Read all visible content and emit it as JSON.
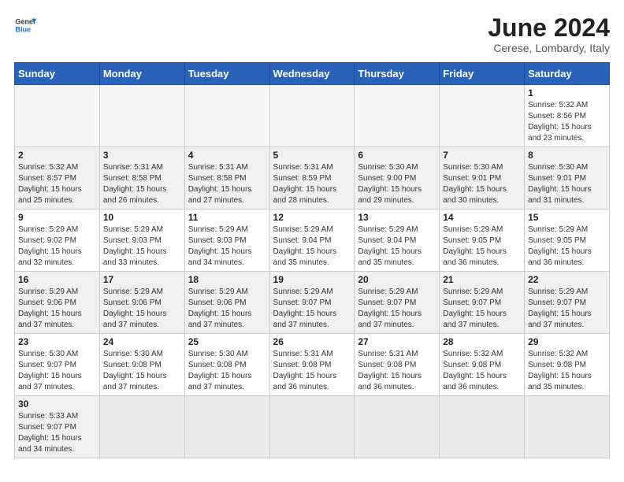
{
  "header": {
    "logo_general": "General",
    "logo_blue": "Blue",
    "month_title": "June 2024",
    "subtitle": "Cerese, Lombardy, Italy"
  },
  "days_of_week": [
    "Sunday",
    "Monday",
    "Tuesday",
    "Wednesday",
    "Thursday",
    "Friday",
    "Saturday"
  ],
  "weeks": [
    [
      {
        "day": "",
        "info": ""
      },
      {
        "day": "",
        "info": ""
      },
      {
        "day": "",
        "info": ""
      },
      {
        "day": "",
        "info": ""
      },
      {
        "day": "",
        "info": ""
      },
      {
        "day": "",
        "info": ""
      },
      {
        "day": "1",
        "info": "Sunrise: 5:32 AM\nSunset: 8:56 PM\nDaylight: 15 hours\nand 23 minutes."
      }
    ],
    [
      {
        "day": "2",
        "info": "Sunrise: 5:32 AM\nSunset: 8:57 PM\nDaylight: 15 hours\nand 25 minutes."
      },
      {
        "day": "3",
        "info": "Sunrise: 5:31 AM\nSunset: 8:58 PM\nDaylight: 15 hours\nand 26 minutes."
      },
      {
        "day": "4",
        "info": "Sunrise: 5:31 AM\nSunset: 8:58 PM\nDaylight: 15 hours\nand 27 minutes."
      },
      {
        "day": "5",
        "info": "Sunrise: 5:31 AM\nSunset: 8:59 PM\nDaylight: 15 hours\nand 28 minutes."
      },
      {
        "day": "6",
        "info": "Sunrise: 5:30 AM\nSunset: 9:00 PM\nDaylight: 15 hours\nand 29 minutes."
      },
      {
        "day": "7",
        "info": "Sunrise: 5:30 AM\nSunset: 9:01 PM\nDaylight: 15 hours\nand 30 minutes."
      },
      {
        "day": "8",
        "info": "Sunrise: 5:30 AM\nSunset: 9:01 PM\nDaylight: 15 hours\nand 31 minutes."
      }
    ],
    [
      {
        "day": "9",
        "info": "Sunrise: 5:29 AM\nSunset: 9:02 PM\nDaylight: 15 hours\nand 32 minutes."
      },
      {
        "day": "10",
        "info": "Sunrise: 5:29 AM\nSunset: 9:03 PM\nDaylight: 15 hours\nand 33 minutes."
      },
      {
        "day": "11",
        "info": "Sunrise: 5:29 AM\nSunset: 9:03 PM\nDaylight: 15 hours\nand 34 minutes."
      },
      {
        "day": "12",
        "info": "Sunrise: 5:29 AM\nSunset: 9:04 PM\nDaylight: 15 hours\nand 35 minutes."
      },
      {
        "day": "13",
        "info": "Sunrise: 5:29 AM\nSunset: 9:04 PM\nDaylight: 15 hours\nand 35 minutes."
      },
      {
        "day": "14",
        "info": "Sunrise: 5:29 AM\nSunset: 9:05 PM\nDaylight: 15 hours\nand 36 minutes."
      },
      {
        "day": "15",
        "info": "Sunrise: 5:29 AM\nSunset: 9:05 PM\nDaylight: 15 hours\nand 36 minutes."
      }
    ],
    [
      {
        "day": "16",
        "info": "Sunrise: 5:29 AM\nSunset: 9:06 PM\nDaylight: 15 hours\nand 37 minutes."
      },
      {
        "day": "17",
        "info": "Sunrise: 5:29 AM\nSunset: 9:06 PM\nDaylight: 15 hours\nand 37 minutes."
      },
      {
        "day": "18",
        "info": "Sunrise: 5:29 AM\nSunset: 9:06 PM\nDaylight: 15 hours\nand 37 minutes."
      },
      {
        "day": "19",
        "info": "Sunrise: 5:29 AM\nSunset: 9:07 PM\nDaylight: 15 hours\nand 37 minutes."
      },
      {
        "day": "20",
        "info": "Sunrise: 5:29 AM\nSunset: 9:07 PM\nDaylight: 15 hours\nand 37 minutes."
      },
      {
        "day": "21",
        "info": "Sunrise: 5:29 AM\nSunset: 9:07 PM\nDaylight: 15 hours\nand 37 minutes."
      },
      {
        "day": "22",
        "info": "Sunrise: 5:29 AM\nSunset: 9:07 PM\nDaylight: 15 hours\nand 37 minutes."
      }
    ],
    [
      {
        "day": "23",
        "info": "Sunrise: 5:30 AM\nSunset: 9:07 PM\nDaylight: 15 hours\nand 37 minutes."
      },
      {
        "day": "24",
        "info": "Sunrise: 5:30 AM\nSunset: 9:08 PM\nDaylight: 15 hours\nand 37 minutes."
      },
      {
        "day": "25",
        "info": "Sunrise: 5:30 AM\nSunset: 9:08 PM\nDaylight: 15 hours\nand 37 minutes."
      },
      {
        "day": "26",
        "info": "Sunrise: 5:31 AM\nSunset: 9:08 PM\nDaylight: 15 hours\nand 36 minutes."
      },
      {
        "day": "27",
        "info": "Sunrise: 5:31 AM\nSunset: 9:08 PM\nDaylight: 15 hours\nand 36 minutes."
      },
      {
        "day": "28",
        "info": "Sunrise: 5:32 AM\nSunset: 9:08 PM\nDaylight: 15 hours\nand 36 minutes."
      },
      {
        "day": "29",
        "info": "Sunrise: 5:32 AM\nSunset: 9:08 PM\nDaylight: 15 hours\nand 35 minutes."
      }
    ],
    [
      {
        "day": "30",
        "info": "Sunrise: 5:33 AM\nSunset: 9:07 PM\nDaylight: 15 hours\nand 34 minutes."
      },
      {
        "day": "",
        "info": ""
      },
      {
        "day": "",
        "info": ""
      },
      {
        "day": "",
        "info": ""
      },
      {
        "day": "",
        "info": ""
      },
      {
        "day": "",
        "info": ""
      },
      {
        "day": "",
        "info": ""
      }
    ]
  ]
}
